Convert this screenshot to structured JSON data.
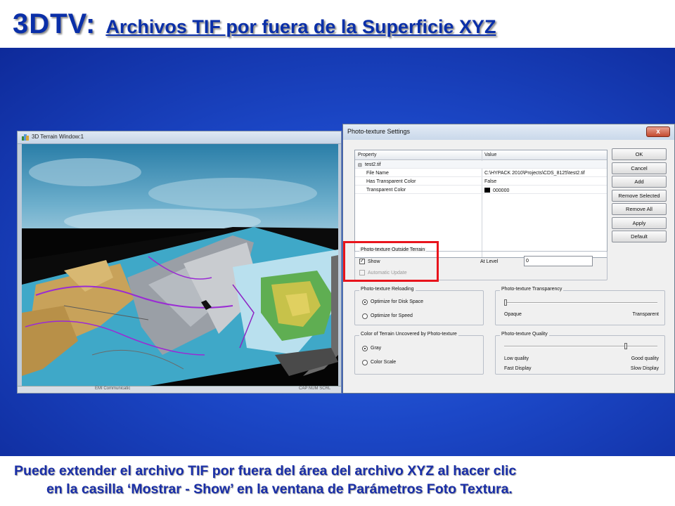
{
  "slide": {
    "title_main": "3DTV:",
    "title_sub": "Archivos TIF por fuera de la Superficie XYZ",
    "caption_line1": "Puede extender el archivo TIF por fuera del área del archivo XYZ al hacer clic",
    "caption_line2": "en la casilla ‘Mostrar - Show’ en la ventana de Parámetros Foto Textura."
  },
  "terrain_window": {
    "title": "3D Terrain Window:1",
    "status_left": "EMI Communicatic",
    "status_right": "CAP NUM SCRL"
  },
  "dialog": {
    "title": "Photo-texture Settings",
    "close_label": "x",
    "grid": {
      "col_property": "Property",
      "col_value": "Value",
      "group_toggle": "⊟",
      "group": "test2.tif",
      "rows": [
        {
          "property": "File Name",
          "value": "C:\\HYPACK 2010\\Projects\\CDS_8125\\test2.tif"
        },
        {
          "property": "Has Transparent Color",
          "value": "False"
        },
        {
          "property": "Transparent Color",
          "value": "000000"
        }
      ]
    },
    "buttons": [
      "OK",
      "Cancel",
      "Add",
      "Remove Selected",
      "Remove All",
      "Apply",
      "Default"
    ],
    "outside_terrain": {
      "label": "Photo-texture Outside Terrain",
      "show_label": "Show",
      "show_checked": true,
      "auto_update_label": "Automatic Update",
      "auto_update_checked": false,
      "at_level_label": "At Level",
      "at_level_value": "0"
    },
    "reloading": {
      "label": "Photo-texture Reloading",
      "options": [
        "Optimize for Disk Space",
        "Optimize for Speed"
      ],
      "selected": 0
    },
    "transparency": {
      "label": "Photo-texture Transparency",
      "min_label": "Opaque",
      "max_label": "Transparent",
      "value_fraction": 0.0
    },
    "uncovered": {
      "label": "Color of Terrain Uncovered by Photo-texture",
      "options": [
        "Gray",
        "Color Scale"
      ],
      "selected": 0
    },
    "quality": {
      "label": "Photo-texture Quality",
      "low_label": "Low quality",
      "high_label": "Good quality",
      "fast_label": "Fast Display",
      "slow_label": "Slow Display",
      "value_fraction": 0.8
    }
  },
  "colors": {
    "title_blue": "#0a2fa8",
    "slide_blue": "#1c48c8",
    "highlight_red": "#e8141c"
  }
}
